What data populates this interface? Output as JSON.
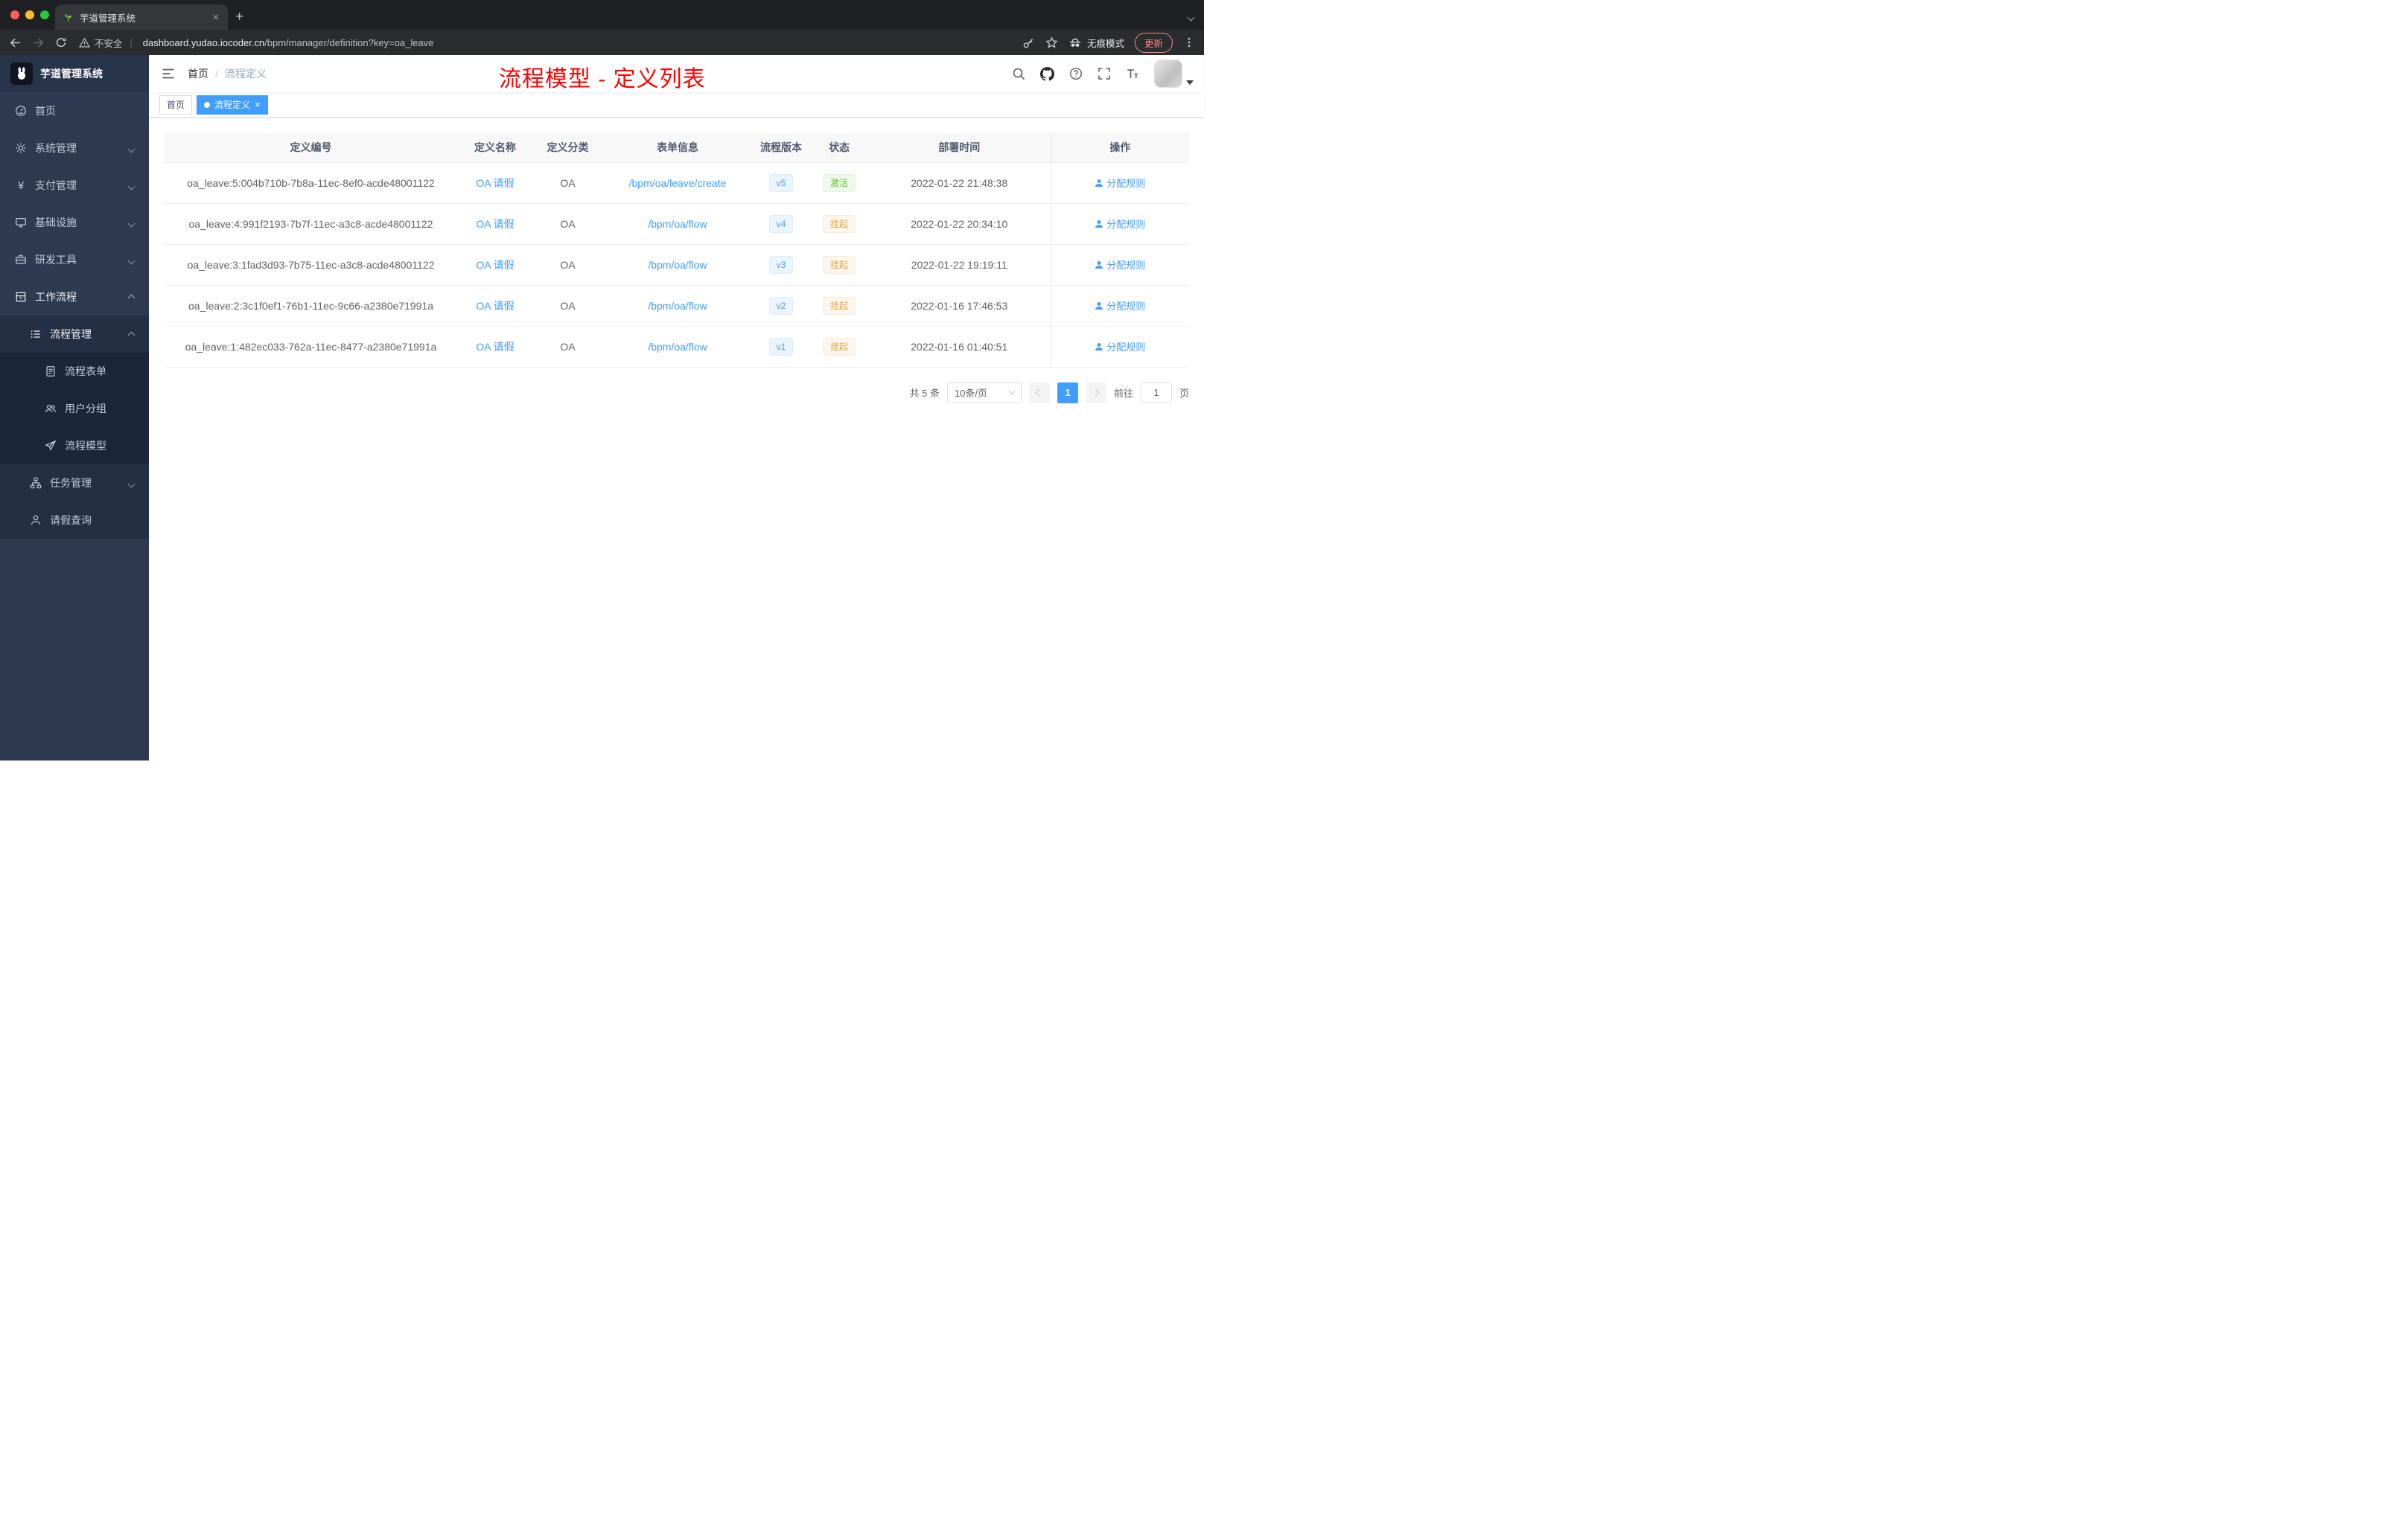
{
  "browser": {
    "tab": {
      "title": "芋道管理系统",
      "close": "×"
    },
    "new_tab": "+",
    "security_label": "不安全",
    "url_host": "dashboard.yudao.iocoder.cn",
    "url_path": "/bpm/manager/definition?key=oa_leave",
    "incognito_label": "无痕模式",
    "update_label": "更新"
  },
  "sidebar": {
    "logo_title": "芋道管理系统",
    "items": [
      {
        "label": "首页"
      },
      {
        "label": "系统管理"
      },
      {
        "label": "支付管理"
      },
      {
        "label": "基础设施"
      },
      {
        "label": "研发工具"
      },
      {
        "label": "工作流程"
      },
      {
        "label": "流程管理"
      },
      {
        "label": "流程表单"
      },
      {
        "label": "用户分组"
      },
      {
        "label": "流程模型"
      },
      {
        "label": "任务管理"
      },
      {
        "label": "请假查询"
      }
    ]
  },
  "navbar": {
    "breadcrumb": {
      "home": "首页",
      "sep": "/",
      "current": "流程定义"
    },
    "annotation": "流程模型 - 定义列表"
  },
  "tags": {
    "home": "首页",
    "active": "流程定义",
    "close": "×"
  },
  "table": {
    "headers": [
      "定义编号",
      "定义名称",
      "定义分类",
      "表单信息",
      "流程版本",
      "状态",
      "部署时间",
      "操作"
    ],
    "rows": [
      {
        "id": "oa_leave:5:004b710b-7b8a-11ec-8ef0-acde48001122",
        "name": "OA 请假",
        "category": "OA",
        "form": "/bpm/oa/leave/create",
        "version": "v5",
        "status": "激活",
        "status_type": "success",
        "deploy_time": "2022-01-22 21:48:38",
        "action": "分配规则"
      },
      {
        "id": "oa_leave:4:991f2193-7b7f-11ec-a3c8-acde48001122",
        "name": "OA 请假",
        "category": "OA",
        "form": "/bpm/oa/flow",
        "version": "v4",
        "status": "挂起",
        "status_type": "warning",
        "deploy_time": "2022-01-22 20:34:10",
        "action": "分配规则"
      },
      {
        "id": "oa_leave:3:1fad3d93-7b75-11ec-a3c8-acde48001122",
        "name": "OA 请假",
        "category": "OA",
        "form": "/bpm/oa/flow",
        "version": "v3",
        "status": "挂起",
        "status_type": "warning",
        "deploy_time": "2022-01-22 19:19:11",
        "action": "分配规则"
      },
      {
        "id": "oa_leave:2:3c1f0ef1-76b1-11ec-9c66-a2380e71991a",
        "name": "OA 请假",
        "category": "OA",
        "form": "/bpm/oa/flow",
        "version": "v2",
        "status": "挂起",
        "status_type": "warning",
        "deploy_time": "2022-01-16 17:46:53",
        "action": "分配规则"
      },
      {
        "id": "oa_leave:1:482ec033-762a-11ec-8477-a2380e71991a",
        "name": "OA 请假",
        "category": "OA",
        "form": "/bpm/oa/flow",
        "version": "v1",
        "status": "挂起",
        "status_type": "warning",
        "deploy_time": "2022-01-16 01:40:51",
        "action": "分配规则"
      }
    ]
  },
  "pagination": {
    "total": "共 5 条",
    "page_size": "10条/页",
    "current_page": "1",
    "goto_label": "前往",
    "goto_value": "1",
    "page_unit": "页"
  }
}
